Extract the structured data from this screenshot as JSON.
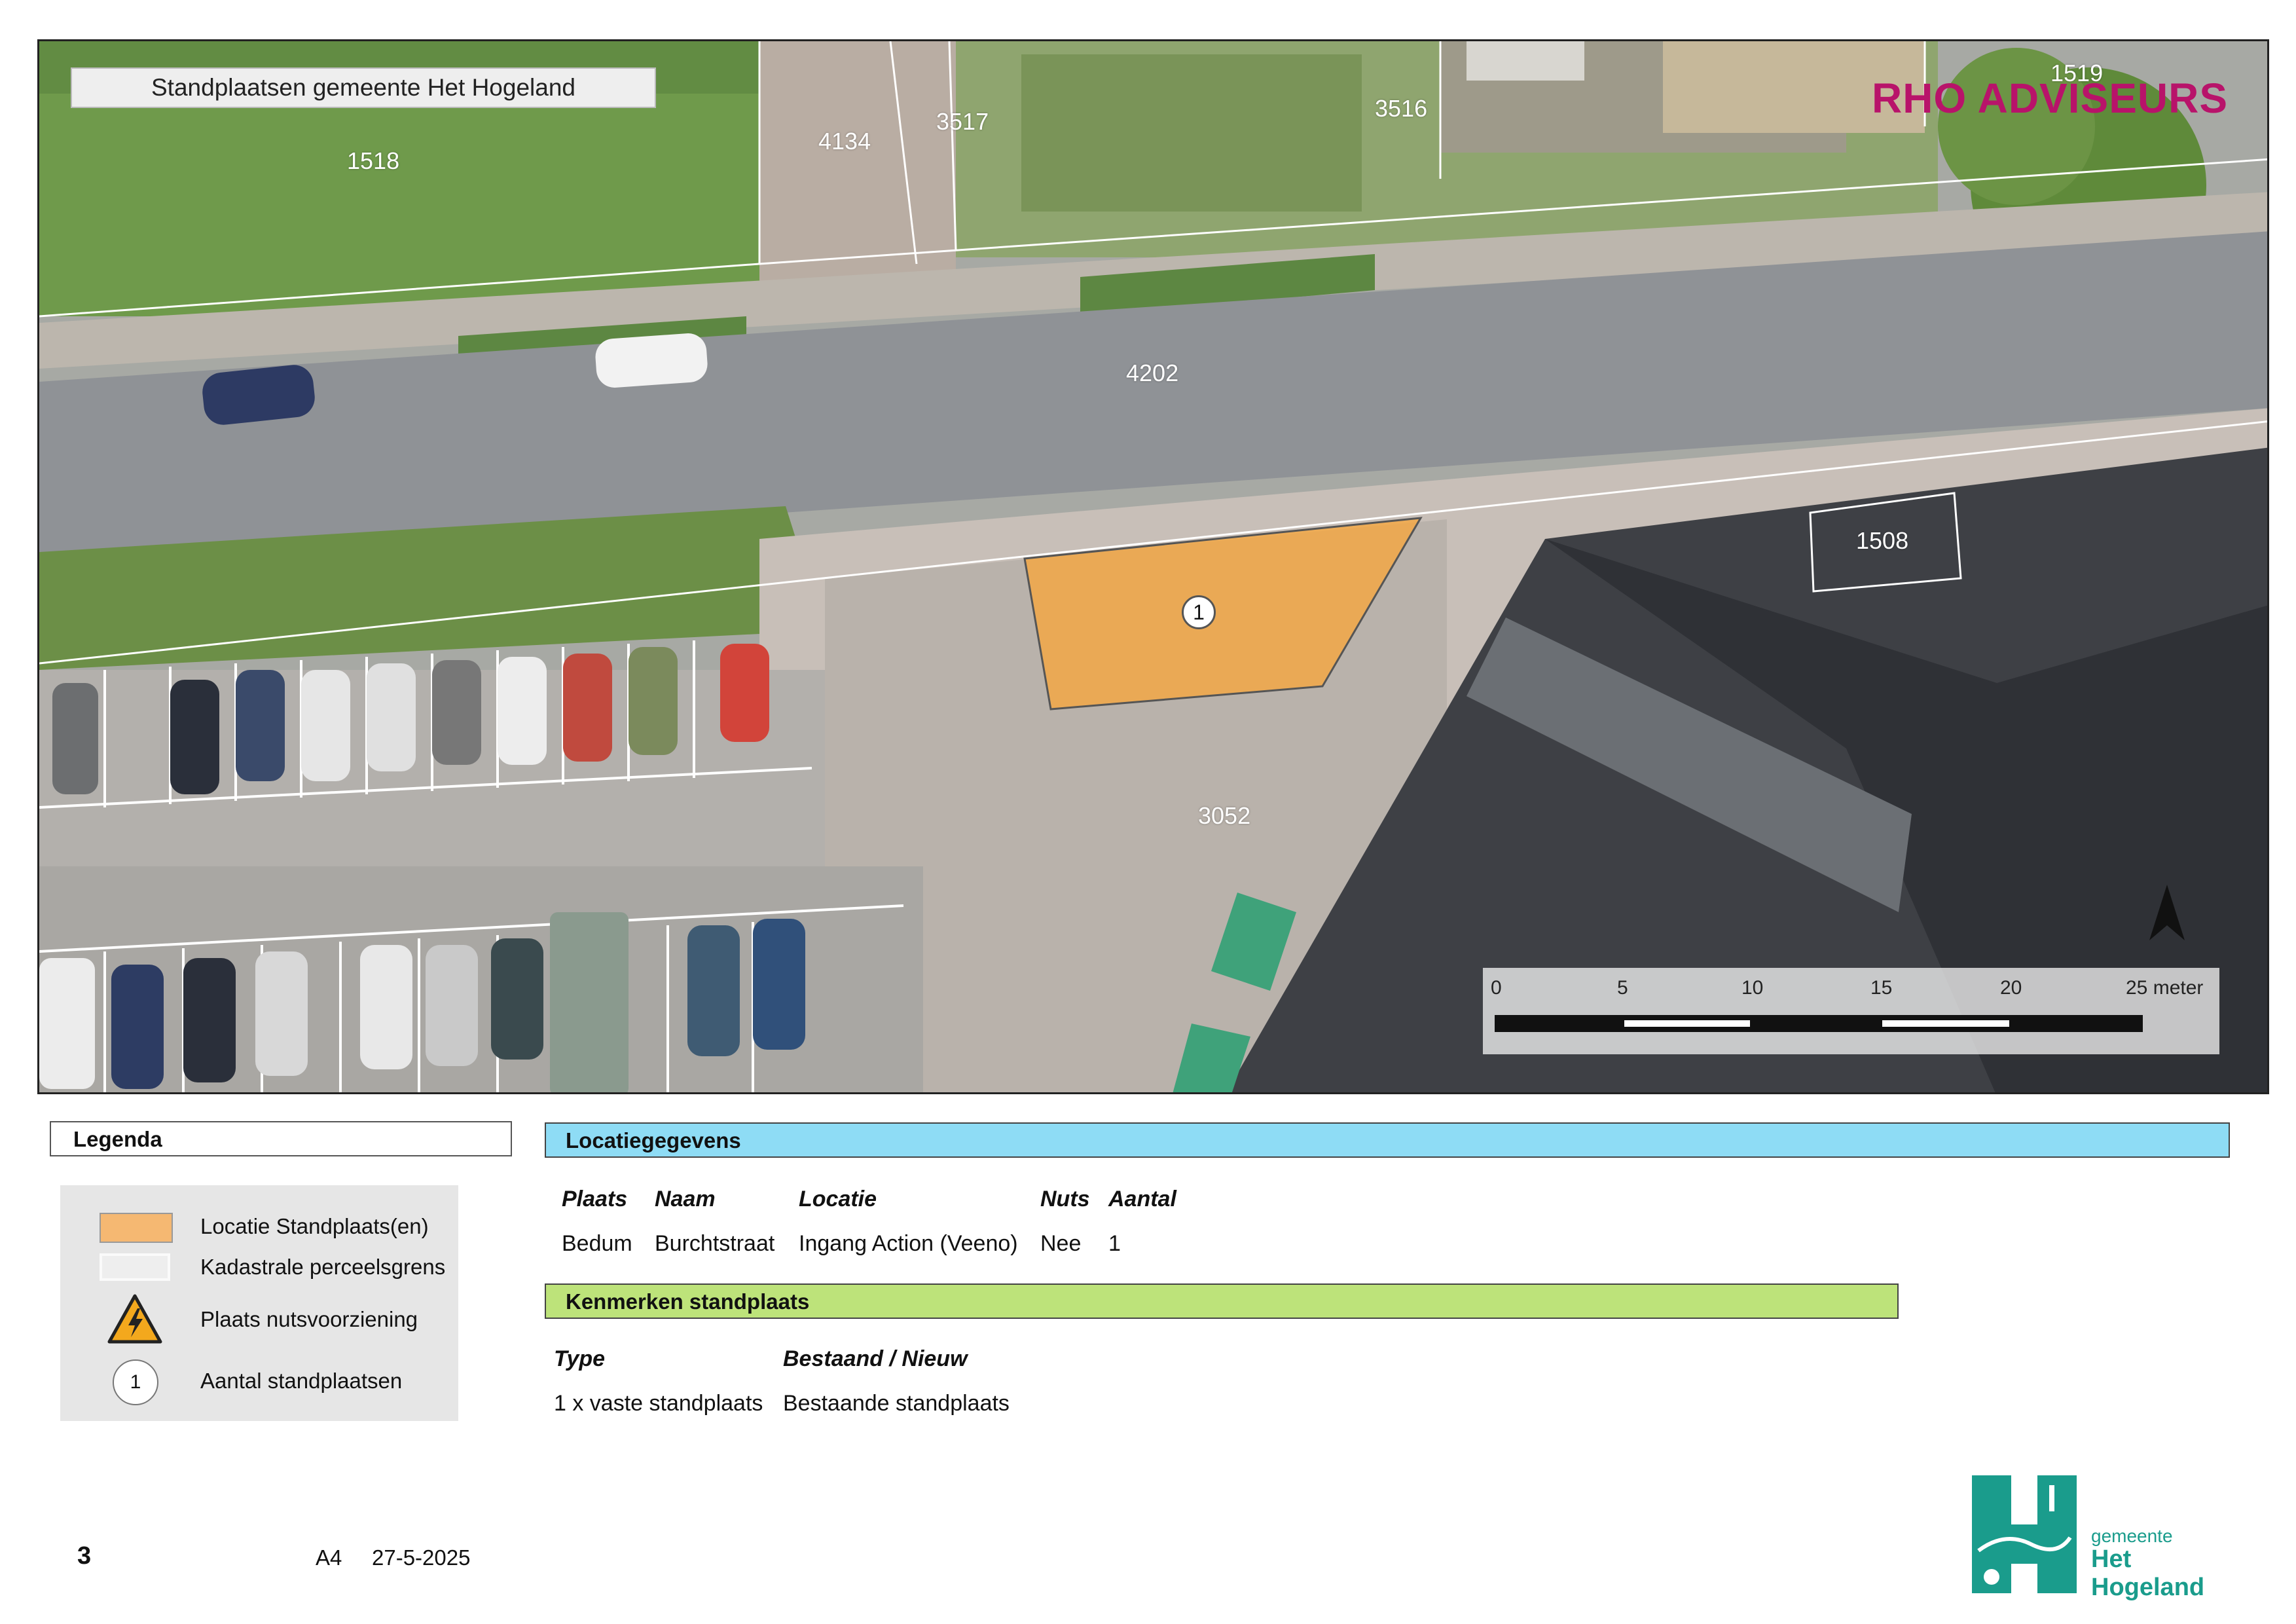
{
  "map": {
    "title": "Standplaatsen gemeente Het Hogeland",
    "brand": "RHO ADVISEURS",
    "parcels": [
      "1518",
      "4134",
      "3517",
      "3516",
      "1519",
      "4202",
      "1508",
      "3052"
    ],
    "marker_count": "1",
    "north_arrow": "north-arrow-icon",
    "scale": {
      "ticks": [
        "0",
        "5",
        "10",
        "15",
        "20",
        "25 meter"
      ]
    },
    "colors": {
      "location": "#f5a742",
      "parcel_line": "#ffffff"
    }
  },
  "legend": {
    "title": "Legenda",
    "items": [
      {
        "label": "Locatie Standplaats(en)",
        "icon": "orange-square"
      },
      {
        "label": "Kadastrale perceelsgrens",
        "icon": "white-outline-square"
      },
      {
        "label": "Plaats nutsvoorziening",
        "icon": "electric-warning-icon"
      },
      {
        "label": "Aantal standplaatsen",
        "icon": "count-circle",
        "value": "1"
      }
    ]
  },
  "locatie": {
    "title": "Locatiegegevens",
    "headers": [
      "Plaats",
      "Naam",
      "Locatie",
      "Nuts",
      "Aantal"
    ],
    "row": [
      "Bedum",
      "Burchtstraat",
      "Ingang Action (Veeno)",
      "Nee",
      "1"
    ]
  },
  "kenmerken": {
    "title": "Kenmerken standplaats",
    "headers": [
      "Type",
      "Bestaand / Nieuw"
    ],
    "row": [
      "1 x vaste standplaats",
      "Bestaande standplaats"
    ]
  },
  "footer": {
    "page": "3",
    "format": "A4",
    "date": "27-5-2025",
    "logo_line1": "gemeente",
    "logo_line2": "Het Hogeland"
  },
  "colors": {
    "locatie_header": "#8edcf5",
    "kenmerken_header": "#bde37a",
    "logo": "#1a9c8c"
  }
}
